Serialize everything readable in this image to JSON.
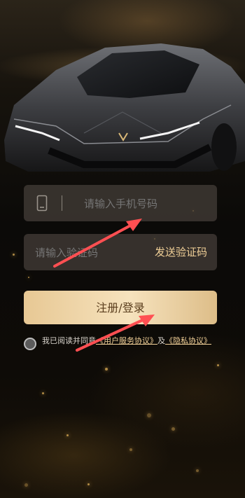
{
  "form": {
    "phone_placeholder": "请输入手机号码",
    "code_placeholder": "请输入验证码",
    "send_code_label": "发送验证码",
    "submit_label": "注册/登录"
  },
  "agreement": {
    "prefix": "我已阅读并同意",
    "user_agreement": "《用户服务协议》",
    "conjunction": "及",
    "privacy_policy": "《隐私协议》"
  },
  "icons": {
    "phone": "phone-icon",
    "checkbox": "radio-unchecked"
  },
  "colors": {
    "accent": "#f0cf97",
    "button_gradient_start": "#e7c894",
    "button_gradient_end": "#f6e2bd",
    "annotation_arrow": "#ff4f52"
  }
}
